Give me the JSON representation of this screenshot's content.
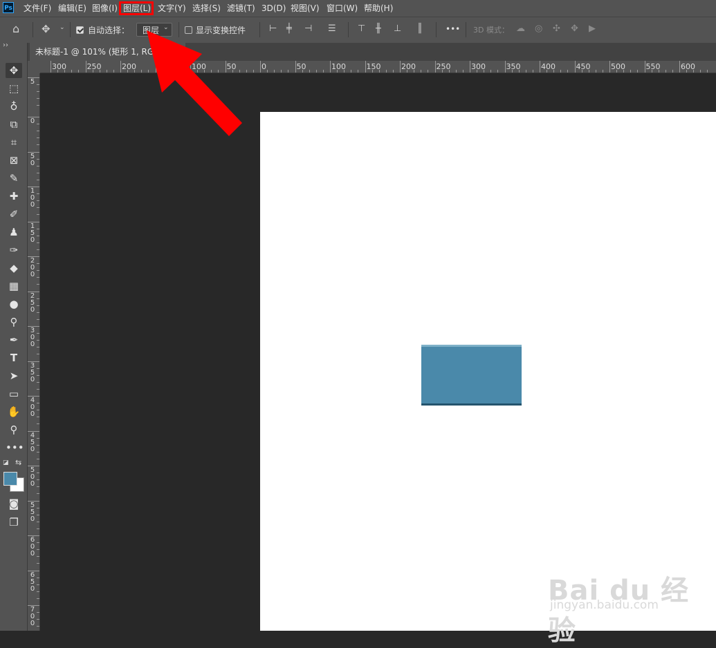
{
  "app": {
    "logo_text": "Ps"
  },
  "menu": [
    {
      "label": "文件(F)"
    },
    {
      "label": "编辑(E)"
    },
    {
      "label": "图像(I)"
    },
    {
      "label": "图层(L)"
    },
    {
      "label": "文字(Y)"
    },
    {
      "label": "选择(S)"
    },
    {
      "label": "滤镜(T)"
    },
    {
      "label": "3D(D)"
    },
    {
      "label": "视图(V)"
    },
    {
      "label": "窗口(W)"
    },
    {
      "label": "帮助(H)"
    }
  ],
  "highlighted_menu": "图层(L)",
  "options_bar": {
    "auto_select_label": "自动选择：",
    "auto_select_checked": true,
    "auto_select_target": "图层",
    "show_transform_label": "显示变换控件",
    "show_transform_checked": false,
    "more_label": "•••",
    "mode_3d_label": "3D 模式："
  },
  "document_tab": {
    "title": "未标题-1 @ 101% (矩形 1, RGB/8"
  },
  "rulers": {
    "horizontal_labels": [
      "300",
      "250",
      "200",
      "150",
      "100",
      "50",
      "0",
      "50",
      "100",
      "150",
      "200",
      "250",
      "300",
      "350",
      "400",
      "450",
      "500",
      "550",
      "600"
    ],
    "vertical_labels": [
      "5",
      "0",
      "5\n0",
      "1\n0\n0",
      "1\n5\n0",
      "2\n0\n0",
      "2\n5\n0",
      "3\n0\n0",
      "3\n5\n0",
      "4\n0\n0",
      "4\n5\n0",
      "5\n0\n0",
      "5\n5\n0",
      "6\n0\n0",
      "6\n5\n0",
      "7\n0\n0"
    ]
  },
  "colors": {
    "foreground": "#4a89aa",
    "background": "#ffffff",
    "highlight": "#ff0000",
    "shape_fill": "#4a89aa"
  },
  "tools": [
    "move-icon",
    "marquee-icon",
    "lasso-icon",
    "object-select-icon",
    "crop-icon",
    "frame-icon",
    "eyedropper-icon",
    "healing-brush-icon",
    "brush-icon",
    "clone-stamp-icon",
    "history-brush-icon",
    "eraser-icon",
    "gradient-icon",
    "blur-icon",
    "dodge-icon",
    "pen-icon",
    "type-icon",
    "path-select-icon",
    "rectangle-icon",
    "hand-icon",
    "zoom-icon",
    "more-tools-icon"
  ],
  "watermark": {
    "brand": "Bai du 经验",
    "url": "jingyan.baidu.com"
  }
}
